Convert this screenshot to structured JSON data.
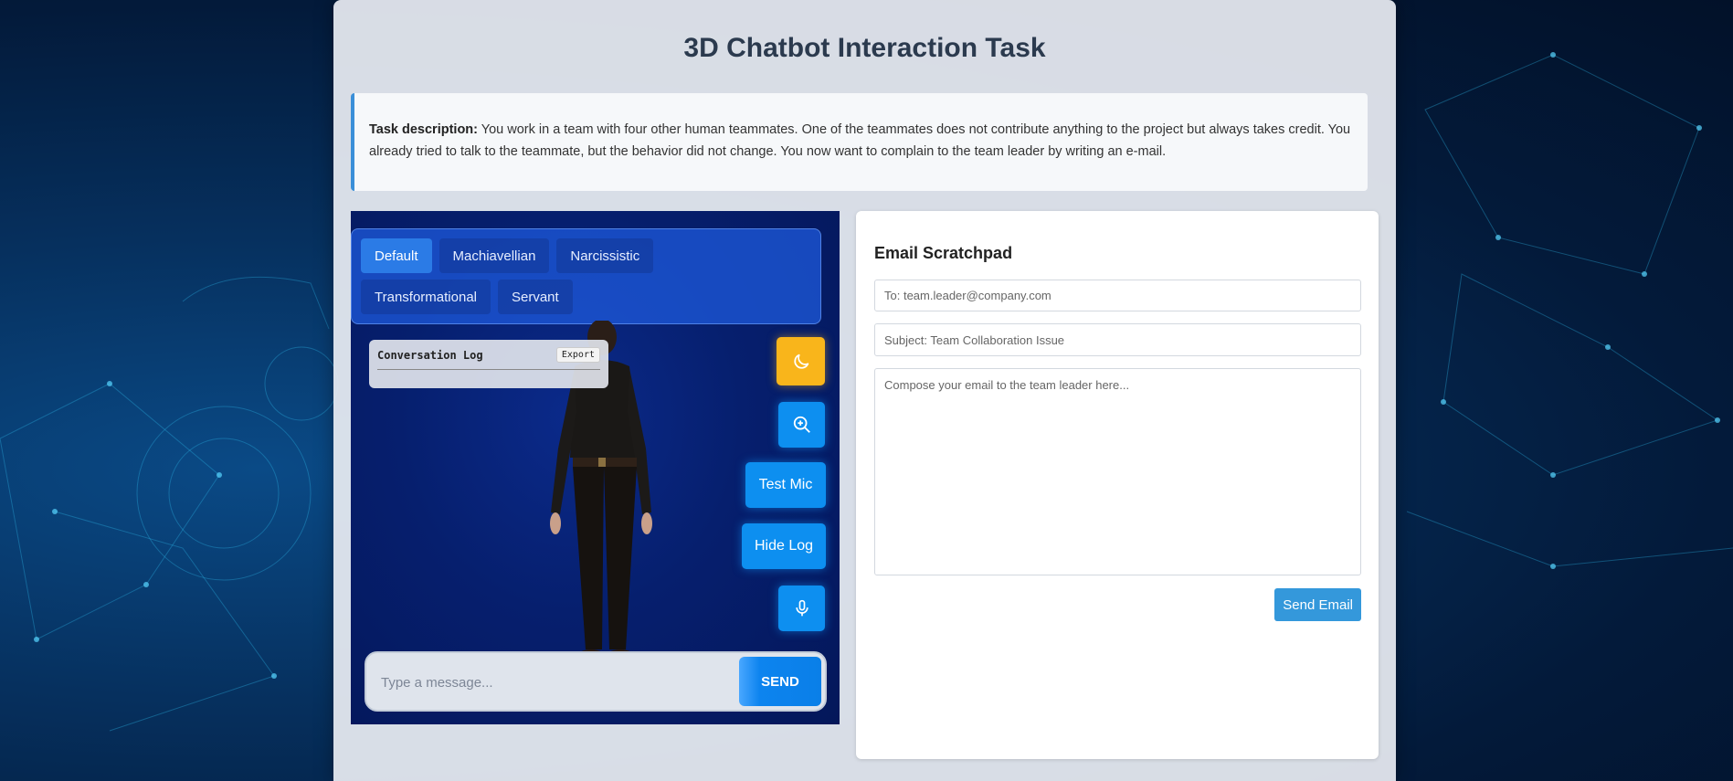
{
  "page": {
    "title": "3D Chatbot Interaction Task"
  },
  "task": {
    "label": "Task description:",
    "text": " You work in a team with four other human teammates. One of the teammates does not contribute anything to the project but always takes credit. You already tried to talk to the teammate, but the behavior did not change. You now want to complain to the team leader by writing an e-mail."
  },
  "viewer": {
    "personas": [
      "Default",
      "Machiavellian",
      "Narcissistic",
      "Transformational",
      "Servant"
    ],
    "active_persona": "Default",
    "log_title": "Conversation Log",
    "export_label": "Export",
    "theme_icon": "moon-icon",
    "zoom_icon": "zoom-in-icon",
    "test_mic_label": "Test Mic",
    "hide_log_label": "Hide Log",
    "mic_icon": "microphone-icon",
    "message_placeholder": "Type a message...",
    "send_label": "SEND"
  },
  "email": {
    "heading": "Email Scratchpad",
    "to_placeholder": "To: team.leader@company.com",
    "subject_placeholder": "Subject: Team Collaboration Issue",
    "body_placeholder": "Compose your email to the team leader here...",
    "send_label": "Send Email"
  },
  "colors": {
    "accent": "#0d8ff0",
    "theme_button": "#f9b51b",
    "send_email": "#3498db"
  }
}
